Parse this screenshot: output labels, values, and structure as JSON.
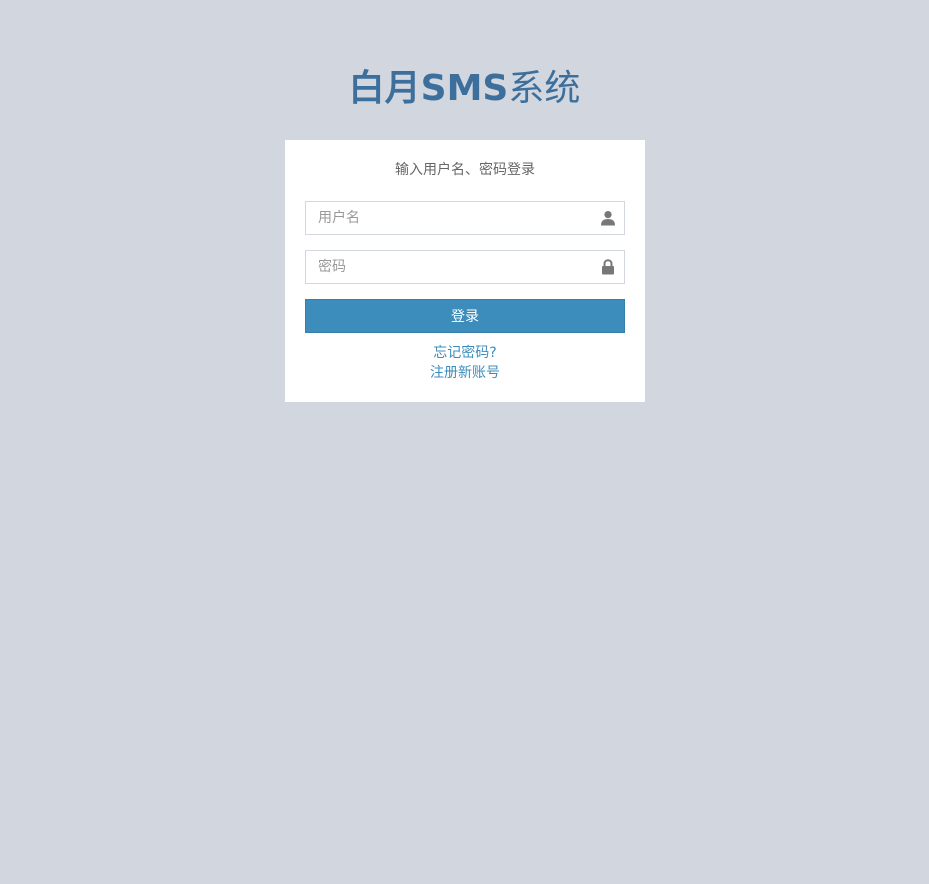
{
  "logo": {
    "part_bold": "白月SMS",
    "part_light": "系统"
  },
  "login": {
    "message": "输入用户名、密码登录",
    "username": {
      "value": "",
      "placeholder": "用户名",
      "icon": "user-icon"
    },
    "password": {
      "value": "",
      "placeholder": "密码",
      "icon": "lock-icon"
    },
    "submit_label": "登录",
    "forgot_password": "忘记密码?",
    "register": "注册新账号"
  },
  "colors": {
    "background": "#d2d6de",
    "brand": "#3c6f9c",
    "primary_button": "#3c8dbc",
    "link": "#3c8dbc",
    "icon": "#777777"
  }
}
